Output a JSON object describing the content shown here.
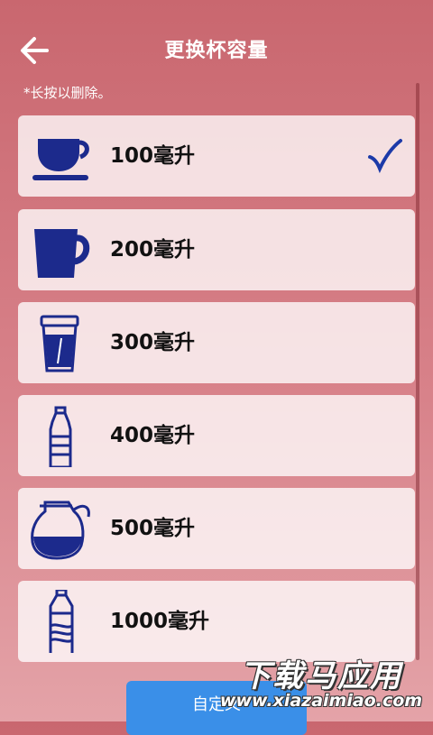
{
  "header": {
    "title": "更换杯容量",
    "back_icon": "back-arrow-icon"
  },
  "hint": "*长按以删除。",
  "colors": {
    "icon": "#1c2a8c",
    "check": "#1c3aa8",
    "button": "#3a8fe8"
  },
  "cups": [
    {
      "label": "100毫升",
      "icon": "teacup-icon",
      "selected": true
    },
    {
      "label": "200毫升",
      "icon": "mug-icon",
      "selected": false
    },
    {
      "label": "300毫升",
      "icon": "paper-cup-icon",
      "selected": false
    },
    {
      "label": "400毫升",
      "icon": "small-bottle-icon",
      "selected": false
    },
    {
      "label": "500毫升",
      "icon": "pitcher-icon",
      "selected": false
    },
    {
      "label": "1000毫升",
      "icon": "large-bottle-icon",
      "selected": false
    }
  ],
  "custom_button": {
    "label": "自定义"
  },
  "watermark": {
    "title": "下载马应用",
    "url": "www.xiazaimiao.com"
  }
}
